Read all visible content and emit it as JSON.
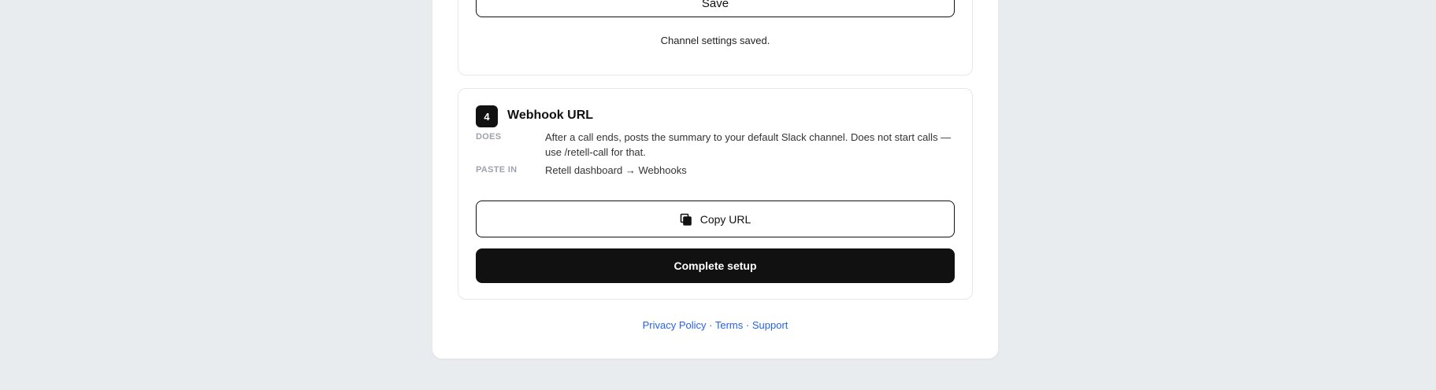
{
  "previous_section": {
    "save_label": "Save",
    "status_message": "Channel settings saved."
  },
  "webhook_section": {
    "step_number": "4",
    "title": "Webhook URL",
    "does_label": "DOES",
    "does_text": "After a call ends, posts the summary to your default Slack channel. Does not start calls — use /retell-call for that.",
    "paste_label": "PASTE IN",
    "paste_text": "Retell dashboard → Webhooks",
    "copy_label": "Copy URL",
    "copy_icon": "copy-icon",
    "complete_label": "Complete setup"
  },
  "footer": {
    "privacy": "Privacy Policy",
    "separator": "·",
    "terms": "Terms",
    "support": "Support"
  },
  "colors": {
    "background": "#e9ecef",
    "card": "#ffffff",
    "primary": "#111111",
    "link": "#2563eb",
    "muted_label": "#9ca3af"
  }
}
